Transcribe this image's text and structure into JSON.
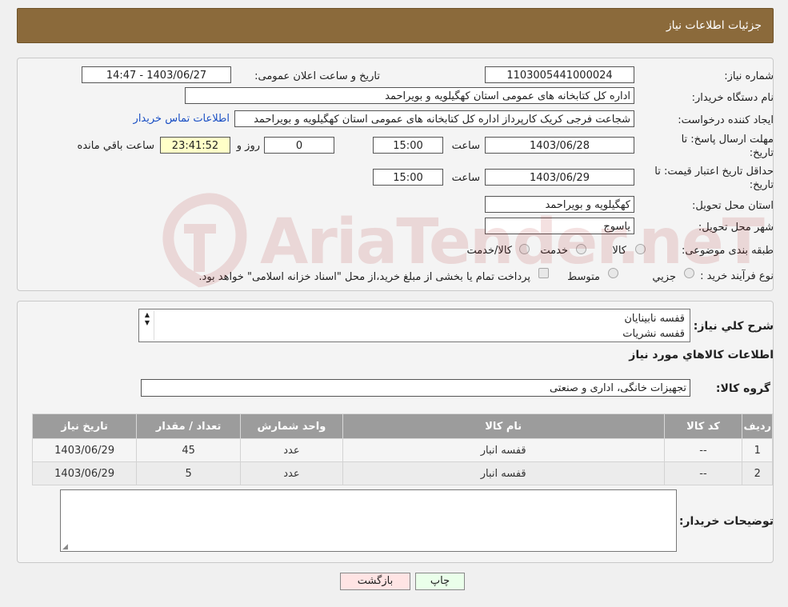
{
  "header": {
    "title": "جزئیات اطلاعات نیاز"
  },
  "form": {
    "need_number_label": "شماره نیاز:",
    "need_number": "1103005441000024",
    "announce_label": "تاریخ و ساعت اعلان عمومی:",
    "announce_value": "1403/06/27 - 14:47",
    "buyer_org_label": "نام دستگاه خریدار:",
    "buyer_org": "اداره کل کتابخانه های عمومی استان کهگیلویه و بویراحمد",
    "requester_label": "ایجاد کننده درخواست:",
    "requester": "شجاعت فرجی کریک کارپرداز اداره کل کتابخانه های عمومی استان کهگیلویه و بویراحمد",
    "contact_link": "اطلاعات تماس خریدار",
    "deadline_label_1": "مهلت ارسال پاسخ: تا",
    "deadline_label_2": "تاریخ:",
    "deadline_date": "1403/06/28",
    "time_label": "ساعت",
    "deadline_time": "15:00",
    "days_value": "0",
    "days_label": "روز و",
    "remaining_time": "23:41:52",
    "remaining_label": "ساعت باقي مانده",
    "validity_label_1": "حداقل تاریخ اعتبار قیمت: تا",
    "validity_label_2": "تاریخ:",
    "validity_date": "1403/06/29",
    "validity_time": "15:00",
    "province_label": "استان محل تحویل:",
    "province": "کهگیلویه و بویراحمد",
    "city_label": "شهر محل تحویل:",
    "city": "یاسوج",
    "category_label": "طبقه بندی موضوعی:",
    "category_options": [
      "کالا",
      "خدمت",
      "کالا/خدمت"
    ],
    "process_label": "نوع فرآیند خرید :",
    "process_options": [
      "جزيي",
      "متوسط"
    ],
    "process_note": "پرداخت تمام یا بخشی از مبلغ خرید،از محل \"اسناد خزانه اسلامی\" خواهد بود."
  },
  "details": {
    "description_label": "شرح کلي نياز:",
    "description_lines": [
      "قفسه نابینایان",
      "قفسه نشریات"
    ],
    "goods_title": "اطلاعات کالاهاي مورد نياز",
    "group_label": "گروه کالا:",
    "group_value": "تجهیزات خانگی، اداری و صنعتی",
    "table": {
      "headers": [
        "رديف",
        "کد کالا",
        "نام کالا",
        "واحد شمارش",
        "تعداد / مقدار",
        "تاریخ نیاز"
      ],
      "rows": [
        [
          "1",
          "--",
          "قفسه انبار",
          "عدد",
          "45",
          "1403/06/29"
        ],
        [
          "2",
          "--",
          "قفسه انبار",
          "عدد",
          "5",
          "1403/06/29"
        ]
      ]
    },
    "buyer_notes_label": "توضیحات خریدار:",
    "buyer_notes": ""
  },
  "buttons": {
    "print": "چاپ",
    "back": "بازگشت"
  },
  "watermark": {
    "text": "AriaTender.neT"
  },
  "colors": {
    "header": "#8b6a3b",
    "back_button": "#ffe4e4",
    "print_button": "#eaffea",
    "link": "#1a4fc4"
  }
}
